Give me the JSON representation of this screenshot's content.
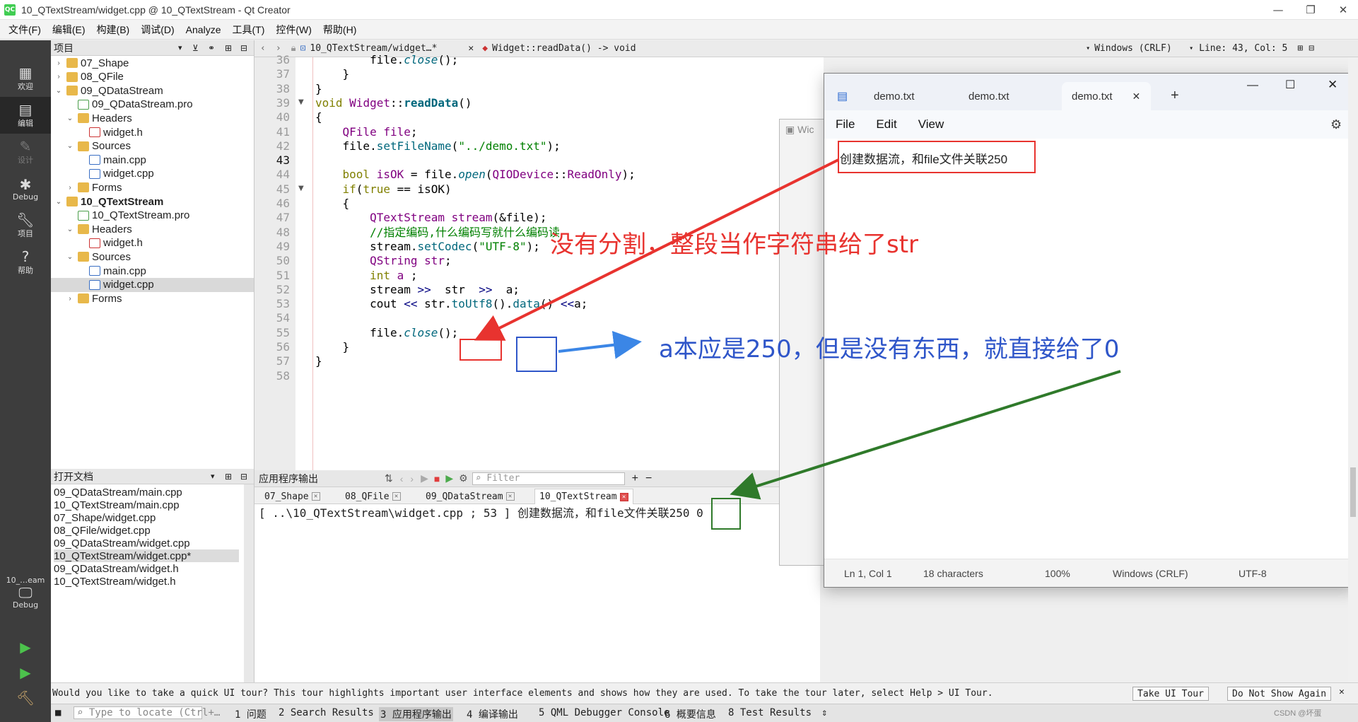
{
  "window": {
    "logo": "QC",
    "title": "10_QTextStream/widget.cpp @ 10_QTextStream - Qt Creator"
  },
  "menubar": [
    "文件(F)",
    "编辑(E)",
    "构建(B)",
    "调试(D)",
    "Analyze",
    "工具(T)",
    "控件(W)",
    "帮助(H)"
  ],
  "modes": [
    {
      "label": "欢迎",
      "icon": "grid-icon"
    },
    {
      "label": "编辑",
      "icon": "edit-icon"
    },
    {
      "label": "设计",
      "icon": "pencil-icon"
    },
    {
      "label": "Debug",
      "icon": "bug-icon"
    },
    {
      "label": "项目",
      "icon": "wrench-icon"
    },
    {
      "label": "帮助",
      "icon": "help-icon"
    }
  ],
  "kit": {
    "project": "10_…eam",
    "mode": "Debug"
  },
  "project_pane": {
    "title": "项目",
    "tree": [
      {
        "label": "07_Shape",
        "icon": "folder",
        "depth": 0,
        "arrow": "›"
      },
      {
        "label": "08_QFile",
        "icon": "folder",
        "depth": 0,
        "arrow": "›"
      },
      {
        "label": "09_QDataStream",
        "icon": "folder",
        "depth": 0,
        "arrow": "⌄"
      },
      {
        "label": "09_QDataStream.pro",
        "icon": "pro",
        "depth": 1,
        "arrow": ""
      },
      {
        "label": "Headers",
        "icon": "folder",
        "depth": 1,
        "arrow": "⌄"
      },
      {
        "label": "widget.h",
        "icon": "h",
        "depth": 2,
        "arrow": ""
      },
      {
        "label": "Sources",
        "icon": "folder",
        "depth": 1,
        "arrow": "⌄"
      },
      {
        "label": "main.cpp",
        "icon": "cpp",
        "depth": 2,
        "arrow": ""
      },
      {
        "label": "widget.cpp",
        "icon": "cpp",
        "depth": 2,
        "arrow": ""
      },
      {
        "label": "Forms",
        "icon": "folder",
        "depth": 1,
        "arrow": "›"
      },
      {
        "label": "10_QTextStream",
        "icon": "folder",
        "depth": 0,
        "arrow": "⌄",
        "bold": true
      },
      {
        "label": "10_QTextStream.pro",
        "icon": "pro",
        "depth": 1,
        "arrow": ""
      },
      {
        "label": "Headers",
        "icon": "folder",
        "depth": 1,
        "arrow": "⌄"
      },
      {
        "label": "widget.h",
        "icon": "h",
        "depth": 2,
        "arrow": ""
      },
      {
        "label": "Sources",
        "icon": "folder",
        "depth": 1,
        "arrow": "⌄"
      },
      {
        "label": "main.cpp",
        "icon": "cpp",
        "depth": 2,
        "arrow": ""
      },
      {
        "label": "widget.cpp",
        "icon": "cpp",
        "depth": 2,
        "arrow": "",
        "selected": true
      },
      {
        "label": "Forms",
        "icon": "folder",
        "depth": 1,
        "arrow": "›"
      }
    ]
  },
  "open_files": {
    "title": "打开文档",
    "items": [
      "09_QDataStream/main.cpp",
      "10_QTextStream/main.cpp",
      "07_Shape/widget.cpp",
      "08_QFile/widget.cpp",
      "09_QDataStream/widget.cpp",
      "10_QTextStream/widget.cpp*",
      "09_QDataStream/widget.h",
      "10_QTextStream/widget.h"
    ],
    "selected_index": 5
  },
  "editor_bar": {
    "file": "10_QTextStream/widget…*",
    "symbol": "Widget::readData() -> void",
    "line_ending": "Windows (CRLF)",
    "position": "Line: 43, Col: 5"
  },
  "code": {
    "current_line": 43,
    "lines": [
      {
        "n": 36,
        "html": "        file.<span class='it'>close</span>();"
      },
      {
        "n": 37,
        "html": "    }"
      },
      {
        "n": 38,
        "html": "}"
      },
      {
        "n": 39,
        "html": "<span class='kw'>void</span> <span class='ty'>Widget</span>::<span class='fnb'>readData</span>()",
        "fold": true
      },
      {
        "n": 40,
        "html": "{"
      },
      {
        "n": 41,
        "html": "    <span class='ty'>QFile</span> <span class='ty'>file</span>;"
      },
      {
        "n": 42,
        "html": "    file.<span class='fn'>setFileName</span>(<span class='st'>\"../demo.txt\"</span>);"
      },
      {
        "n": 43,
        "html": ""
      },
      {
        "n": 44,
        "html": "    <span class='kw'>bool</span> <span class='ty'>isOK</span> = file.<span class='it'>open</span>(<span class='ty'>QIODevice</span>::<span class='ty'>ReadOnly</span>);"
      },
      {
        "n": 45,
        "html": "    <span class='kw'>if</span>(<span class='kw'>true</span> == isOK)",
        "fold": true
      },
      {
        "n": 46,
        "html": "    {"
      },
      {
        "n": 47,
        "html": "        <span class='ty'>QTextStream</span> <span class='ty'>stream</span>(&amp;file);"
      },
      {
        "n": 48,
        "html": "        <span class='cm'>//指定编码,什么编码写就什么编码读</span>"
      },
      {
        "n": 49,
        "html": "        stream.<span class='fn'>setCodec</span>(<span class='st'>\"UTF-8\"</span>);"
      },
      {
        "n": 50,
        "html": "        <span class='ty'>QString</span> <span class='ty'>str</span>;"
      },
      {
        "n": 51,
        "html": "        <span class='kw'>int</span> <span class='ty'>a</span> ;"
      },
      {
        "n": 52,
        "html": "        stream <span class='op'>&gt;&gt;</span>  str  <span class='op'>&gt;&gt;</span>  a;"
      },
      {
        "n": 53,
        "html": "        cout <span class='op'>&lt;&lt;</span> str.<span class='fn'>toUtf8</span>().<span class='fn'>data</span>() <span class='op'>&lt;&lt;</span>a;"
      },
      {
        "n": 54,
        "html": ""
      },
      {
        "n": 55,
        "html": "        file.<span class='it'>close</span>();"
      },
      {
        "n": 56,
        "html": "    }"
      },
      {
        "n": 57,
        "html": "}"
      },
      {
        "n": 58,
        "html": ""
      }
    ]
  },
  "output": {
    "title": "应用程序输出",
    "filter_placeholder": "Filter",
    "tabs": [
      "07_Shape",
      "08_QFile",
      "09_QDataStream",
      "10_QTextStream"
    ],
    "active_tab": 3,
    "line": "[ ..\\10_QTextStream\\widget.cpp ; 53 ] 创建数据流，和file文件关联250",
    "value": "0"
  },
  "background_window": {
    "title": "Wic"
  },
  "notepad": {
    "tabs": [
      "demo.txt",
      "demo.txt",
      "demo.txt"
    ],
    "active_tab": 2,
    "menu": [
      "File",
      "Edit",
      "View"
    ],
    "content": "创建数据流，和file文件关联250",
    "status": {
      "pos": "Ln 1, Col 1",
      "chars": "18 characters",
      "zoom": "100%",
      "eol": "Windows (CRLF)",
      "enc": "UTF-8"
    }
  },
  "annotations": {
    "red": "没有分割，整段当作字符串给了str",
    "blue": "a本应是250，但是没有东西，就直接给了0",
    "colors": {
      "red": "#e8332f",
      "blue": "#2f56c9",
      "green": "#2f7a2a"
    }
  },
  "tour_bar": {
    "text": "Would you like to take a quick UI tour? This tour highlights important user interface elements and shows how they are used. To take the tour later, select Help > UI Tour.",
    "take": "Take UI Tour",
    "dismiss": "Do Not Show Again"
  },
  "statusbar": {
    "locate_placeholder": "Type to locate (Ctrl+…",
    "items": [
      "1 问题",
      "2 Search Results",
      "3 应用程序输出",
      "4 编译输出",
      "5 QML Debugger Console",
      "6 概要信息",
      "8 Test Results"
    ],
    "watermark": "CSDN @坏蛋"
  }
}
